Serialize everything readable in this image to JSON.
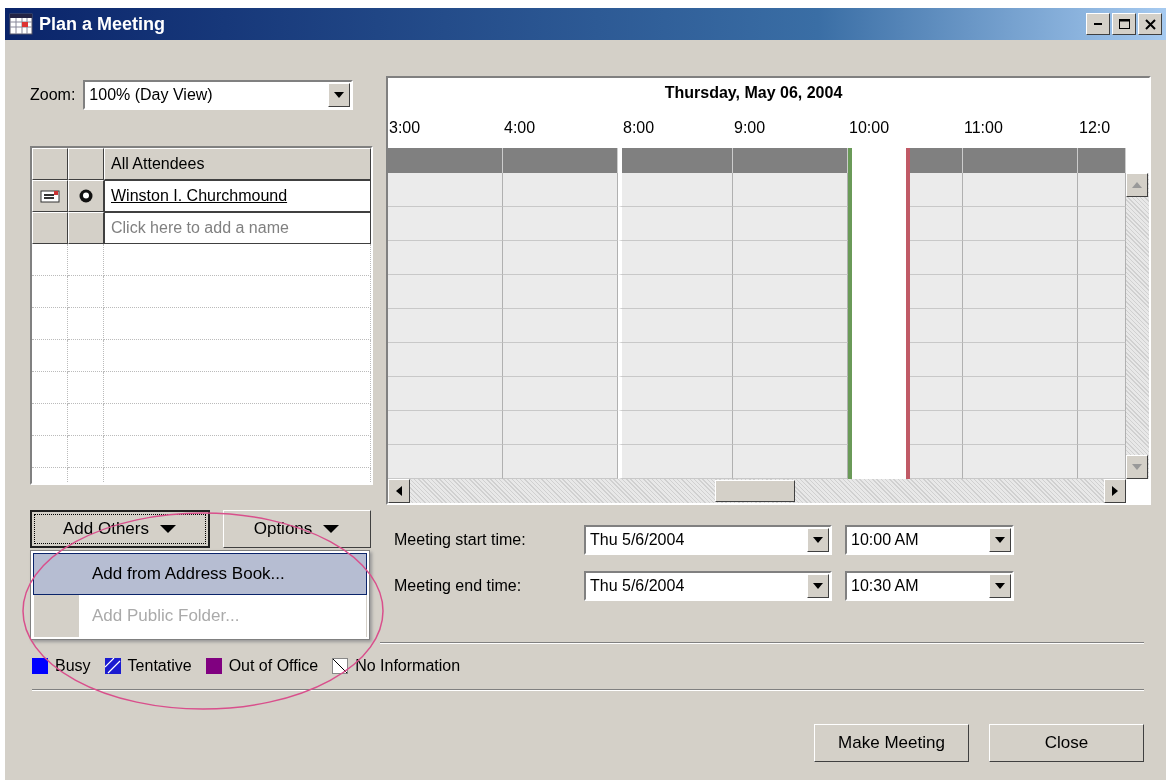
{
  "window": {
    "title": "Plan a Meeting"
  },
  "zoom": {
    "label": "Zoom:",
    "value": "100% (Day View)"
  },
  "attendees": {
    "header": "All Attendees",
    "rows": [
      {
        "name": "Winston I. Churchmound",
        "kind": "organizer"
      }
    ],
    "placeholder": "Click here to add a name"
  },
  "schedule": {
    "date": "Thursday, May 06, 2004",
    "columns": [
      {
        "label": "3:00",
        "break_before": false,
        "meeting_start": false
      },
      {
        "label": "4:00",
        "break_before": false,
        "meeting_start": false
      },
      {
        "label": "8:00",
        "break_before": true,
        "meeting_start": false
      },
      {
        "label": "9:00",
        "break_before": false,
        "meeting_start": false
      },
      {
        "label": "10:00",
        "break_before": false,
        "meeting_start": true
      },
      {
        "label": "11:00",
        "break_before": false,
        "meeting_start": false
      },
      {
        "label": "12:0",
        "break_before": false,
        "meeting_start": false
      }
    ]
  },
  "add_others": {
    "label": "Add Others",
    "expanded": true
  },
  "options": {
    "label": "Options"
  },
  "menu": [
    {
      "label": "Add from Address Book...",
      "selected": true,
      "disabled": false
    },
    {
      "label": "Add Public Folder...",
      "selected": false,
      "disabled": true
    }
  ],
  "times": [
    {
      "label": "Meeting start time:",
      "date": "Thu 5/6/2004",
      "time": "10:00 AM"
    },
    {
      "label": "Meeting end time:",
      "date": "Thu 5/6/2004",
      "time": "10:30 AM"
    }
  ],
  "legend": [
    {
      "label": "Busy",
      "kind": "solid",
      "color": "#0000ff"
    },
    {
      "label": "Tentative",
      "kind": "hatched",
      "color": "#1a1ad0"
    },
    {
      "label": "Out of Office",
      "kind": "solid",
      "color": "#800080"
    },
    {
      "label": "No Information",
      "kind": "empty",
      "color": "#ffffff"
    }
  ],
  "buttons": [
    {
      "label": "Make Meeting"
    },
    {
      "label": "Close"
    }
  ],
  "annotation": {
    "kind": "ellipse"
  }
}
